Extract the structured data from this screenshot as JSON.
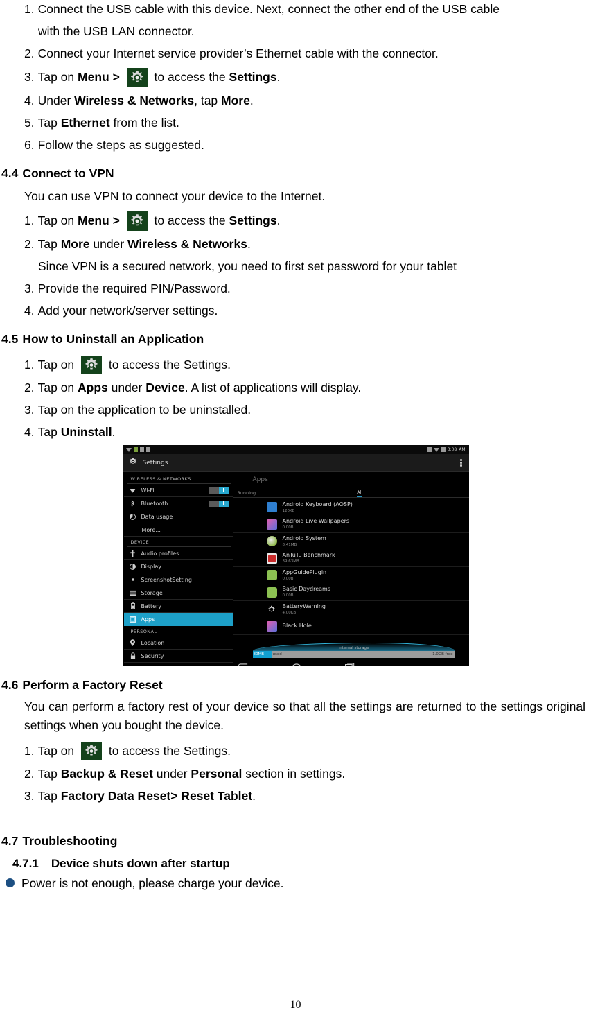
{
  "document": {
    "page_number": "10"
  },
  "intro_steps": {
    "items": [
      {
        "num": "1.",
        "parts": [
          {
            "t": "Connect the USB cable with this device. Next, connect the other end of the USB cable with the USB LAN connector.",
            "b": false
          }
        ]
      },
      {
        "num": "2.",
        "parts": [
          {
            "t": "Connect your Internet service provider’s Ethernet cable with the connector.",
            "b": false
          }
        ]
      }
    ],
    "step1_line1": "Connect the USB cable with this device. Next, connect the other end of the USB cable",
    "step1_line2": "with the USB LAN connector.",
    "step2": "Connect your Internet service provider’s Ethernet cable with the connector.",
    "step3_pre": "Tap on ",
    "step3_menu": "Menu >",
    "step3_mid": " to access the ",
    "step3_settings": "Settings",
    "step3_end": ".",
    "step4_pre": "Under ",
    "step4_bold1": "Wireless & Networks",
    "step4_mid": ", tap ",
    "step4_bold2": "More",
    "step4_end": ".",
    "step5_pre": "Tap ",
    "step5_bold": "Ethernet",
    "step5_end": " from the list.",
    "step6": "Follow the steps as suggested.",
    "n3": "3.",
    "n4": "4.",
    "n5": "5.",
    "n6": "6."
  },
  "section_44": {
    "number": "4.4",
    "title": "Connect to VPN",
    "intro": "You can use VPN to connect your device to the Internet.",
    "n1": "1.",
    "n2": "2.",
    "n3": "3.",
    "n4": "4.",
    "step1_pre": "Tap on ",
    "step1_menu": "Menu >",
    "step1_mid": " to access the ",
    "step1_settings": "Settings",
    "step1_end": ".",
    "step2_pre": "Tap ",
    "step2_bold1": "More",
    "step2_mid": " under ",
    "step2_bold2": "Wireless & Networks",
    "step2_end": ".",
    "note": "Since VPN is a secured network, you need to first set password for your tablet",
    "step3": "Provide the required PIN/Password.",
    "step4": "Add your network/server settings."
  },
  "section_45": {
    "number": "4.5",
    "title": "How to Uninstall an Application",
    "n1": "1.",
    "n2": "2.",
    "n3": "3.",
    "n4": "4.",
    "step1_pre": "Tap on ",
    "step1_post": " to access the Settings.",
    "step2_pre": "Tap on ",
    "step2_bold1": "Apps",
    "step2_mid": " under ",
    "step2_bold2": "Device",
    "step2_end": ". A list of applications will display.",
    "step3": "Tap on the application to be uninstalled.",
    "step4_pre": "Tap ",
    "step4_bold": "Uninstall",
    "step4_end": "."
  },
  "section_46": {
    "number": "4.6",
    "title": "Perform a Factory Reset",
    "paragraph": "You can perform a factory rest of your device so that all the settings are returned to the settings original settings when you bought the device.",
    "n1": "1.",
    "n2": "2.",
    "n3": "3.",
    "step1_pre": "Tap on ",
    "step1_post": " to access the Settings.",
    "step2_pre": "Tap ",
    "step2_bold1": "Backup & Reset",
    "step2_mid": " under ",
    "step2_bold2": "Personal",
    "step2_end": " section in settings.",
    "step3_pre": "Tap ",
    "step3_bold": "Factory Data Reset> Reset Tablet",
    "step3_end": "."
  },
  "section_47": {
    "number": "4.7",
    "title": "Troubleshooting",
    "sub_number": "4.7.1",
    "sub_title": "Device shuts down after startup",
    "bullet": "Power is not enough, please charge your device."
  },
  "screenshot": {
    "status_bar": {
      "time": "3:08",
      "meridiem": "AM"
    },
    "action_bar": {
      "title": "Settings"
    },
    "sidebar": {
      "categories": [
        {
          "label": "WIRELESS & NETWORKS",
          "items": [
            {
              "label": "Wi-Fi",
              "icon": "wifi-icon",
              "toggle": "on"
            },
            {
              "label": "Bluetooth",
              "icon": "bluetooth-icon",
              "toggle": "on"
            },
            {
              "label": "Data usage",
              "icon": "data-usage-icon",
              "toggle": "none"
            },
            {
              "label": "More...",
              "icon": "none",
              "toggle": "none"
            }
          ]
        },
        {
          "label": "DEVICE",
          "items": [
            {
              "label": "Audio profiles",
              "icon": "audio-icon",
              "toggle": "none"
            },
            {
              "label": "Display",
              "icon": "display-icon",
              "toggle": "none"
            },
            {
              "label": "ScreenshotSetting",
              "icon": "screenshot-icon",
              "toggle": "none"
            },
            {
              "label": "Storage",
              "icon": "storage-icon",
              "toggle": "none"
            },
            {
              "label": "Battery",
              "icon": "battery-icon",
              "toggle": "none"
            },
            {
              "label": "Apps",
              "icon": "apps-icon",
              "toggle": "none",
              "selected": true
            }
          ]
        },
        {
          "label": "PERSONAL",
          "items": [
            {
              "label": "Location",
              "icon": "location-icon",
              "toggle": "none"
            },
            {
              "label": "Security",
              "icon": "lock-icon",
              "toggle": "none"
            }
          ]
        }
      ]
    },
    "main": {
      "title": "Apps",
      "tabs": [
        {
          "label": "Running",
          "selected": false
        },
        {
          "label": "All",
          "selected": true
        }
      ],
      "apps": [
        {
          "name": "Android Keyboard (AOSP)",
          "size": "120KB",
          "color": "#2f7fd0"
        },
        {
          "name": "Android Live Wallpapers",
          "size": "0.00B",
          "color": "#d24fa0"
        },
        {
          "name": "Android System",
          "size": "8.41MB",
          "color": "#3c8f3c"
        },
        {
          "name": "AnTuTu Benchmark",
          "size": "39.63MB",
          "color": "#c92b2b"
        },
        {
          "name": "AppGuidePlugin",
          "size": "0.00B",
          "color": "#8cc152"
        },
        {
          "name": "Basic Daydreams",
          "size": "0.00B",
          "color": "#8cc152"
        },
        {
          "name": "BatteryWarning",
          "size": "4.00KB",
          "color": "#9a9a9a"
        },
        {
          "name": "Black Hole",
          "size": "",
          "color": "#d24fa0"
        }
      ],
      "storage": {
        "label": "Internal storage",
        "used": "80MB",
        "used_suffix": "used",
        "free": "1.0GB free"
      }
    },
    "navbar": {
      "back": "back-icon",
      "home": "home-icon",
      "recents": "recents-icon"
    }
  },
  "colors": {
    "accent_blue": "#1da0c8",
    "gear_bg": "#14421b",
    "bullet": "#1c4f82"
  }
}
